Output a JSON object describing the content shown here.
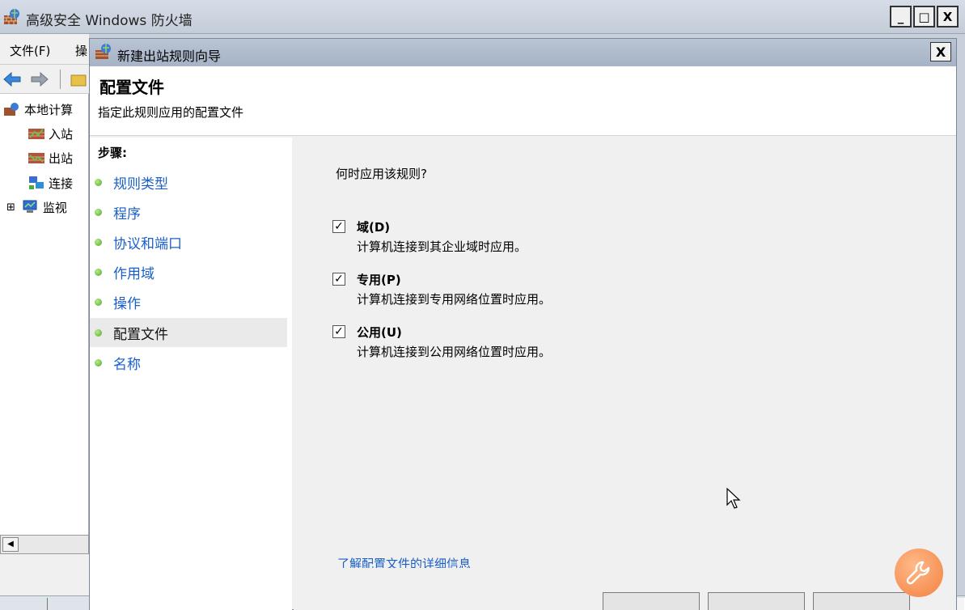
{
  "main_window": {
    "title": "高级安全 Windows 防火墙",
    "controls": {
      "minimize": "_",
      "maximize": "□",
      "close": "X"
    },
    "menu": [
      "文件(F)",
      "操"
    ],
    "tree": [
      {
        "label": "本地计算",
        "icon": "firewall-icon"
      },
      {
        "label": "入站",
        "icon": "inbound-rules-icon"
      },
      {
        "label": "出站",
        "icon": "outbound-rules-icon"
      },
      {
        "label": "连接",
        "icon": "connection-security-icon"
      },
      {
        "label": "监视",
        "icon": "monitoring-icon",
        "expander": "⊞"
      }
    ]
  },
  "dialog": {
    "title": "新建出站规则向导",
    "close_label": "X",
    "heading": "配置文件",
    "subheading": "指定此规则应用的配置文件",
    "steps_title": "步骤:",
    "steps": [
      {
        "label": "规则类型",
        "active": false
      },
      {
        "label": "程序",
        "active": false
      },
      {
        "label": "协议和端口",
        "active": false
      },
      {
        "label": "作用域",
        "active": false
      },
      {
        "label": "操作",
        "active": false
      },
      {
        "label": "配置文件",
        "active": true
      },
      {
        "label": "名称",
        "active": false
      }
    ],
    "question": "何时应用该规则?",
    "options": [
      {
        "label": "域(D)",
        "checked": true,
        "description": "计算机连接到其企业域时应用。"
      },
      {
        "label": "专用(P)",
        "checked": true,
        "description": "计算机连接到专用网络位置时应用。"
      },
      {
        "label": "公用(U)",
        "checked": true,
        "description": "计算机连接到公用网络位置时应用。"
      }
    ],
    "learn_more_link": "了解配置文件的详细信息"
  },
  "colors": {
    "link": "#1a5fc9",
    "titlebar": "#a6b3c6",
    "step_dot": "#4fa82c",
    "help_badge": "#f2813f"
  }
}
